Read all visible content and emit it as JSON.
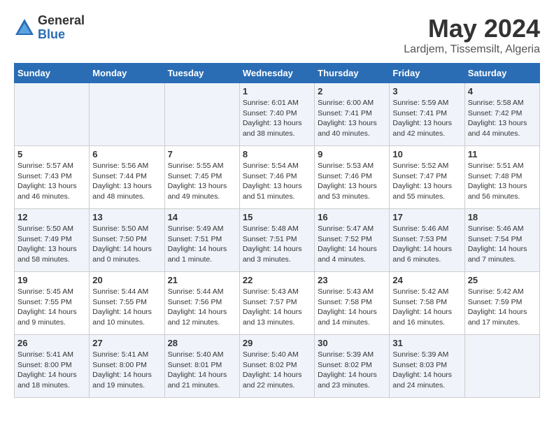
{
  "header": {
    "logo_general": "General",
    "logo_blue": "Blue",
    "month_title": "May 2024",
    "location": "Lardjem, Tissemsilt, Algeria"
  },
  "weekdays": [
    "Sunday",
    "Monday",
    "Tuesday",
    "Wednesday",
    "Thursday",
    "Friday",
    "Saturday"
  ],
  "weeks": [
    [
      {
        "day": "",
        "info": ""
      },
      {
        "day": "",
        "info": ""
      },
      {
        "day": "",
        "info": ""
      },
      {
        "day": "1",
        "info": "Sunrise: 6:01 AM\nSunset: 7:40 PM\nDaylight: 13 hours\nand 38 minutes."
      },
      {
        "day": "2",
        "info": "Sunrise: 6:00 AM\nSunset: 7:41 PM\nDaylight: 13 hours\nand 40 minutes."
      },
      {
        "day": "3",
        "info": "Sunrise: 5:59 AM\nSunset: 7:41 PM\nDaylight: 13 hours\nand 42 minutes."
      },
      {
        "day": "4",
        "info": "Sunrise: 5:58 AM\nSunset: 7:42 PM\nDaylight: 13 hours\nand 44 minutes."
      }
    ],
    [
      {
        "day": "5",
        "info": "Sunrise: 5:57 AM\nSunset: 7:43 PM\nDaylight: 13 hours\nand 46 minutes."
      },
      {
        "day": "6",
        "info": "Sunrise: 5:56 AM\nSunset: 7:44 PM\nDaylight: 13 hours\nand 48 minutes."
      },
      {
        "day": "7",
        "info": "Sunrise: 5:55 AM\nSunset: 7:45 PM\nDaylight: 13 hours\nand 49 minutes."
      },
      {
        "day": "8",
        "info": "Sunrise: 5:54 AM\nSunset: 7:46 PM\nDaylight: 13 hours\nand 51 minutes."
      },
      {
        "day": "9",
        "info": "Sunrise: 5:53 AM\nSunset: 7:46 PM\nDaylight: 13 hours\nand 53 minutes."
      },
      {
        "day": "10",
        "info": "Sunrise: 5:52 AM\nSunset: 7:47 PM\nDaylight: 13 hours\nand 55 minutes."
      },
      {
        "day": "11",
        "info": "Sunrise: 5:51 AM\nSunset: 7:48 PM\nDaylight: 13 hours\nand 56 minutes."
      }
    ],
    [
      {
        "day": "12",
        "info": "Sunrise: 5:50 AM\nSunset: 7:49 PM\nDaylight: 13 hours\nand 58 minutes."
      },
      {
        "day": "13",
        "info": "Sunrise: 5:50 AM\nSunset: 7:50 PM\nDaylight: 14 hours\nand 0 minutes."
      },
      {
        "day": "14",
        "info": "Sunrise: 5:49 AM\nSunset: 7:51 PM\nDaylight: 14 hours\nand 1 minute."
      },
      {
        "day": "15",
        "info": "Sunrise: 5:48 AM\nSunset: 7:51 PM\nDaylight: 14 hours\nand 3 minutes."
      },
      {
        "day": "16",
        "info": "Sunrise: 5:47 AM\nSunset: 7:52 PM\nDaylight: 14 hours\nand 4 minutes."
      },
      {
        "day": "17",
        "info": "Sunrise: 5:46 AM\nSunset: 7:53 PM\nDaylight: 14 hours\nand 6 minutes."
      },
      {
        "day": "18",
        "info": "Sunrise: 5:46 AM\nSunset: 7:54 PM\nDaylight: 14 hours\nand 7 minutes."
      }
    ],
    [
      {
        "day": "19",
        "info": "Sunrise: 5:45 AM\nSunset: 7:55 PM\nDaylight: 14 hours\nand 9 minutes."
      },
      {
        "day": "20",
        "info": "Sunrise: 5:44 AM\nSunset: 7:55 PM\nDaylight: 14 hours\nand 10 minutes."
      },
      {
        "day": "21",
        "info": "Sunrise: 5:44 AM\nSunset: 7:56 PM\nDaylight: 14 hours\nand 12 minutes."
      },
      {
        "day": "22",
        "info": "Sunrise: 5:43 AM\nSunset: 7:57 PM\nDaylight: 14 hours\nand 13 minutes."
      },
      {
        "day": "23",
        "info": "Sunrise: 5:43 AM\nSunset: 7:58 PM\nDaylight: 14 hours\nand 14 minutes."
      },
      {
        "day": "24",
        "info": "Sunrise: 5:42 AM\nSunset: 7:58 PM\nDaylight: 14 hours\nand 16 minutes."
      },
      {
        "day": "25",
        "info": "Sunrise: 5:42 AM\nSunset: 7:59 PM\nDaylight: 14 hours\nand 17 minutes."
      }
    ],
    [
      {
        "day": "26",
        "info": "Sunrise: 5:41 AM\nSunset: 8:00 PM\nDaylight: 14 hours\nand 18 minutes."
      },
      {
        "day": "27",
        "info": "Sunrise: 5:41 AM\nSunset: 8:00 PM\nDaylight: 14 hours\nand 19 minutes."
      },
      {
        "day": "28",
        "info": "Sunrise: 5:40 AM\nSunset: 8:01 PM\nDaylight: 14 hours\nand 21 minutes."
      },
      {
        "day": "29",
        "info": "Sunrise: 5:40 AM\nSunset: 8:02 PM\nDaylight: 14 hours\nand 22 minutes."
      },
      {
        "day": "30",
        "info": "Sunrise: 5:39 AM\nSunset: 8:02 PM\nDaylight: 14 hours\nand 23 minutes."
      },
      {
        "day": "31",
        "info": "Sunrise: 5:39 AM\nSunset: 8:03 PM\nDaylight: 14 hours\nand 24 minutes."
      },
      {
        "day": "",
        "info": ""
      }
    ]
  ]
}
